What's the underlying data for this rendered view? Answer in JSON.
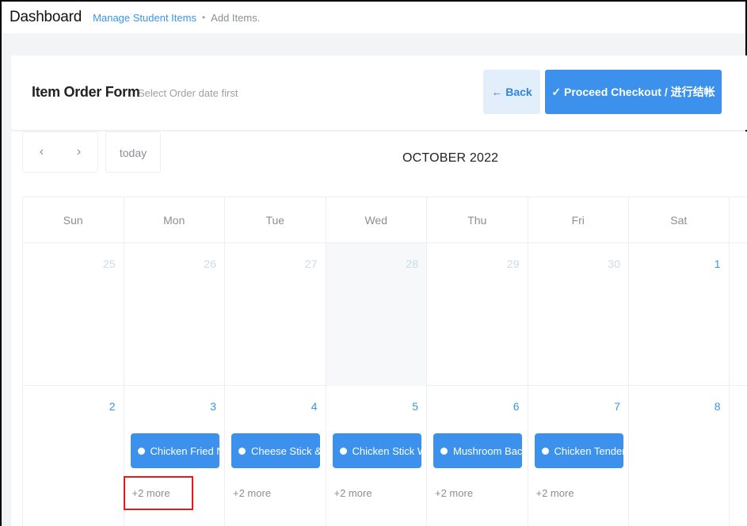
{
  "topbar": {
    "title": "Dashboard",
    "crumb_link": "Manage Student Items",
    "crumb_sep": "•",
    "crumb_current": "Add Items."
  },
  "header": {
    "form_title": "Item Order Form",
    "form_subtitle": "Select Order date first",
    "back_label": "← Back",
    "checkout_label": "✓ Proceed Checkout / 进行结帐"
  },
  "calendar": {
    "prev_icon": "‹",
    "next_icon": "›",
    "today_label": "today",
    "month_title": "OCTOBER 2022",
    "days_of_week": [
      "Sun",
      "Mon",
      "Tue",
      "Wed",
      "Thu",
      "Fri",
      "Sat"
    ],
    "week1": [
      "25",
      "26",
      "27",
      "28",
      "29",
      "30",
      "1"
    ],
    "week2": [
      "2",
      "3",
      "4",
      "5",
      "6",
      "7",
      "8"
    ],
    "events": [
      "Chicken Fried N",
      "Cheese Stick &",
      "Chicken Stick W",
      "Mushroom Bac",
      "Chicken Tender"
    ],
    "more_label": "+2 more"
  },
  "colors": {
    "accent": "#3b91ec",
    "link": "#3a95e8",
    "highlight": "#e21b1b"
  }
}
